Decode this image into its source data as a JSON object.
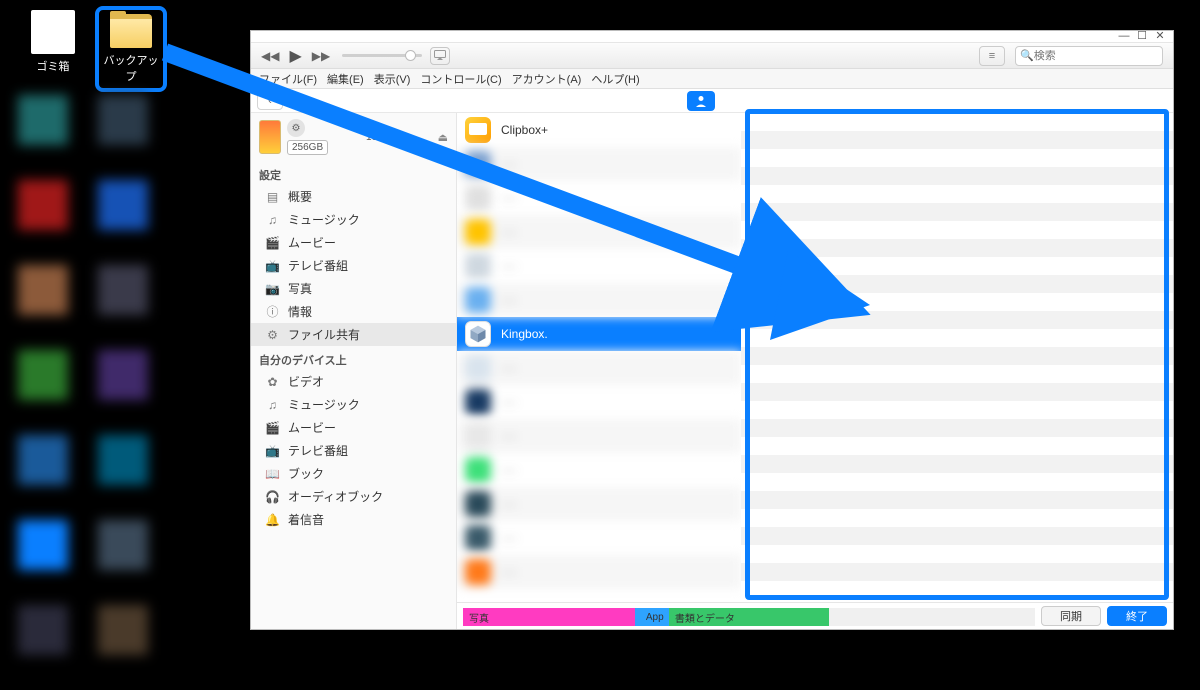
{
  "desktop": {
    "recycle_label": "ゴミ箱",
    "backup_folder_label": "バックアップ"
  },
  "window_controls": {
    "min": "—",
    "max": "☐",
    "close": "✕"
  },
  "toolbar": {
    "prev_icon": "◀◀",
    "play_icon": "▶",
    "next_icon": "▶▶",
    "airplay_icon": "⎚",
    "list_icon": "≡",
    "search_icon": "🔍",
    "search_placeholder": "検索"
  },
  "menubar": {
    "file": "ファイル(F)",
    "edit": "編集(E)",
    "view": "表示(V)",
    "control": "コントロール(C)",
    "account": "アカウント(A)",
    "help": "ヘルプ(H)"
  },
  "subbar": {
    "back": "‹"
  },
  "device": {
    "capacity": "256GB",
    "battery": "100% ▮",
    "eject": "⏏"
  },
  "sidebar": {
    "group_settings": "設定",
    "settings": [
      {
        "icon": "▤",
        "label": "概要"
      },
      {
        "icon": "♫",
        "label": "ミュージック"
      },
      {
        "icon": "🎬",
        "label": "ムービー"
      },
      {
        "icon": "📺",
        "label": "テレビ番組"
      },
      {
        "icon": "📷",
        "label": "写真"
      },
      {
        "icon": "ⓘ",
        "label": "情報"
      },
      {
        "icon": "⚙",
        "label": "ファイル共有",
        "selected": true
      }
    ],
    "group_on_device": "自分のデバイス上",
    "on_device": [
      {
        "icon": "✿",
        "label": "ビデオ"
      },
      {
        "icon": "♫",
        "label": "ミュージック"
      },
      {
        "icon": "🎬",
        "label": "ムービー"
      },
      {
        "icon": "📺",
        "label": "テレビ番組"
      },
      {
        "icon": "📖",
        "label": "ブック"
      },
      {
        "icon": "🎧",
        "label": "オーディオブック"
      },
      {
        "icon": "🔔",
        "label": "着信音"
      }
    ]
  },
  "apps": {
    "clipbox": "Clipbox+",
    "kingbox": "Kingbox."
  },
  "usage": {
    "photos": {
      "label": "写真",
      "color": "#ff3bc1",
      "width": "30%"
    },
    "app": {
      "label": "App",
      "color": "#2ea3ff",
      "width": "6%"
    },
    "docs": {
      "label": "書類とデータ",
      "color": "#38c76a",
      "width": "28%"
    }
  },
  "buttons": {
    "sync": "同期",
    "done": "終了"
  }
}
